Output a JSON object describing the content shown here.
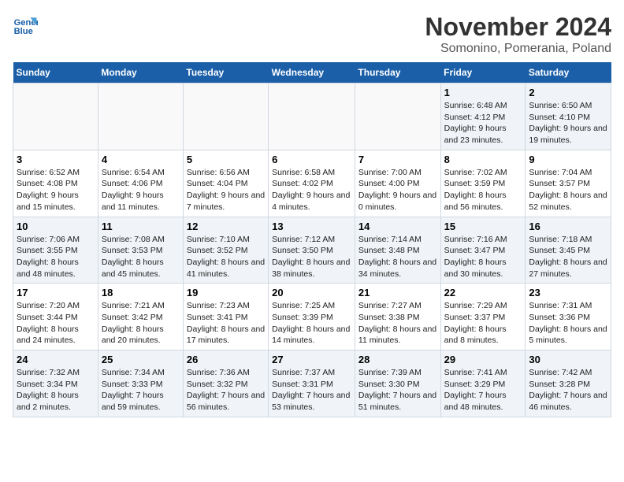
{
  "logo": {
    "line1": "General",
    "line2": "Blue"
  },
  "title": "November 2024",
  "subtitle": "Somonino, Pomerania, Poland",
  "weekdays": [
    "Sunday",
    "Monday",
    "Tuesday",
    "Wednesday",
    "Thursday",
    "Friday",
    "Saturday"
  ],
  "weeks": [
    [
      {
        "day": "",
        "info": ""
      },
      {
        "day": "",
        "info": ""
      },
      {
        "day": "",
        "info": ""
      },
      {
        "day": "",
        "info": ""
      },
      {
        "day": "",
        "info": ""
      },
      {
        "day": "1",
        "info": "Sunrise: 6:48 AM\nSunset: 4:12 PM\nDaylight: 9 hours and 23 minutes."
      },
      {
        "day": "2",
        "info": "Sunrise: 6:50 AM\nSunset: 4:10 PM\nDaylight: 9 hours and 19 minutes."
      }
    ],
    [
      {
        "day": "3",
        "info": "Sunrise: 6:52 AM\nSunset: 4:08 PM\nDaylight: 9 hours and 15 minutes."
      },
      {
        "day": "4",
        "info": "Sunrise: 6:54 AM\nSunset: 4:06 PM\nDaylight: 9 hours and 11 minutes."
      },
      {
        "day": "5",
        "info": "Sunrise: 6:56 AM\nSunset: 4:04 PM\nDaylight: 9 hours and 7 minutes."
      },
      {
        "day": "6",
        "info": "Sunrise: 6:58 AM\nSunset: 4:02 PM\nDaylight: 9 hours and 4 minutes."
      },
      {
        "day": "7",
        "info": "Sunrise: 7:00 AM\nSunset: 4:00 PM\nDaylight: 9 hours and 0 minutes."
      },
      {
        "day": "8",
        "info": "Sunrise: 7:02 AM\nSunset: 3:59 PM\nDaylight: 8 hours and 56 minutes."
      },
      {
        "day": "9",
        "info": "Sunrise: 7:04 AM\nSunset: 3:57 PM\nDaylight: 8 hours and 52 minutes."
      }
    ],
    [
      {
        "day": "10",
        "info": "Sunrise: 7:06 AM\nSunset: 3:55 PM\nDaylight: 8 hours and 48 minutes."
      },
      {
        "day": "11",
        "info": "Sunrise: 7:08 AM\nSunset: 3:53 PM\nDaylight: 8 hours and 45 minutes."
      },
      {
        "day": "12",
        "info": "Sunrise: 7:10 AM\nSunset: 3:52 PM\nDaylight: 8 hours and 41 minutes."
      },
      {
        "day": "13",
        "info": "Sunrise: 7:12 AM\nSunset: 3:50 PM\nDaylight: 8 hours and 38 minutes."
      },
      {
        "day": "14",
        "info": "Sunrise: 7:14 AM\nSunset: 3:48 PM\nDaylight: 8 hours and 34 minutes."
      },
      {
        "day": "15",
        "info": "Sunrise: 7:16 AM\nSunset: 3:47 PM\nDaylight: 8 hours and 30 minutes."
      },
      {
        "day": "16",
        "info": "Sunrise: 7:18 AM\nSunset: 3:45 PM\nDaylight: 8 hours and 27 minutes."
      }
    ],
    [
      {
        "day": "17",
        "info": "Sunrise: 7:20 AM\nSunset: 3:44 PM\nDaylight: 8 hours and 24 minutes."
      },
      {
        "day": "18",
        "info": "Sunrise: 7:21 AM\nSunset: 3:42 PM\nDaylight: 8 hours and 20 minutes."
      },
      {
        "day": "19",
        "info": "Sunrise: 7:23 AM\nSunset: 3:41 PM\nDaylight: 8 hours and 17 minutes."
      },
      {
        "day": "20",
        "info": "Sunrise: 7:25 AM\nSunset: 3:39 PM\nDaylight: 8 hours and 14 minutes."
      },
      {
        "day": "21",
        "info": "Sunrise: 7:27 AM\nSunset: 3:38 PM\nDaylight: 8 hours and 11 minutes."
      },
      {
        "day": "22",
        "info": "Sunrise: 7:29 AM\nSunset: 3:37 PM\nDaylight: 8 hours and 8 minutes."
      },
      {
        "day": "23",
        "info": "Sunrise: 7:31 AM\nSunset: 3:36 PM\nDaylight: 8 hours and 5 minutes."
      }
    ],
    [
      {
        "day": "24",
        "info": "Sunrise: 7:32 AM\nSunset: 3:34 PM\nDaylight: 8 hours and 2 minutes."
      },
      {
        "day": "25",
        "info": "Sunrise: 7:34 AM\nSunset: 3:33 PM\nDaylight: 7 hours and 59 minutes."
      },
      {
        "day": "26",
        "info": "Sunrise: 7:36 AM\nSunset: 3:32 PM\nDaylight: 7 hours and 56 minutes."
      },
      {
        "day": "27",
        "info": "Sunrise: 7:37 AM\nSunset: 3:31 PM\nDaylight: 7 hours and 53 minutes."
      },
      {
        "day": "28",
        "info": "Sunrise: 7:39 AM\nSunset: 3:30 PM\nDaylight: 7 hours and 51 minutes."
      },
      {
        "day": "29",
        "info": "Sunrise: 7:41 AM\nSunset: 3:29 PM\nDaylight: 7 hours and 48 minutes."
      },
      {
        "day": "30",
        "info": "Sunrise: 7:42 AM\nSunset: 3:28 PM\nDaylight: 7 hours and 46 minutes."
      }
    ]
  ]
}
